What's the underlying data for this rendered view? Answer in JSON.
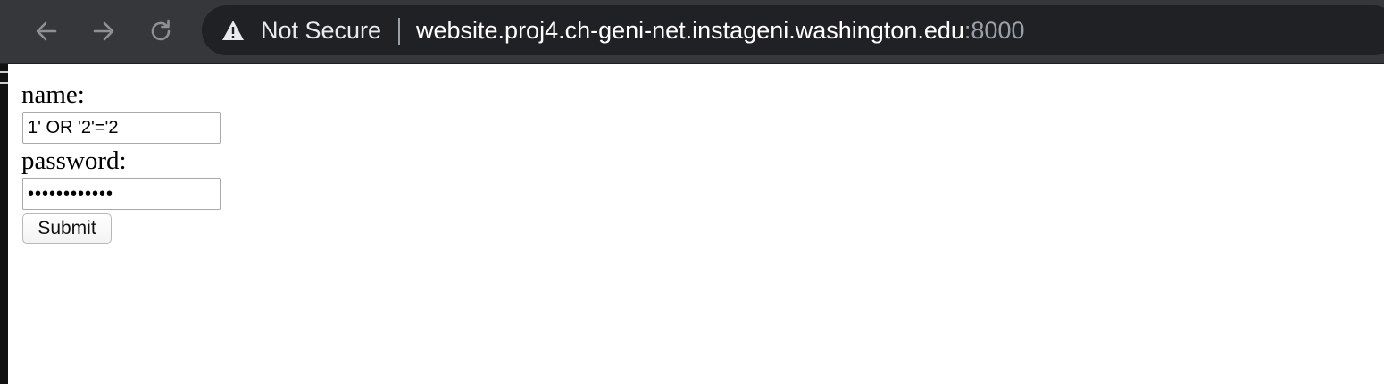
{
  "browser": {
    "security_label": "Not Secure",
    "url_host": "website.proj4.ch-geni-net.instageni.washington.edu",
    "url_port": ":8000",
    "icons": {
      "back": "arrow-left-icon",
      "forward": "arrow-right-icon",
      "reload": "reload-icon",
      "security": "warning-triangle-icon"
    }
  },
  "form": {
    "name_label": "name:",
    "name_value": "1' OR '2'='2",
    "password_label": "password:",
    "password_value": "••••••••••••",
    "submit_label": "Submit"
  },
  "colors": {
    "toolbar": "#36373a",
    "address_bar": "#202124",
    "url_text": "#ffffff",
    "port_text": "#9aa0a6"
  }
}
